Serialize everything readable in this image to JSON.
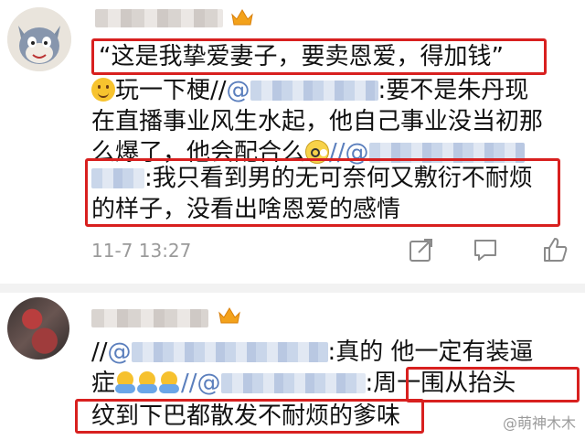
{
  "comment1": {
    "line1": "“这是我挚爱妻子，要卖恩爱，得加钱”",
    "line2_a": "玩一下梗//",
    "line2_mention": "@",
    "line2_b": ":要不是朱丹现",
    "line3": "在直播事业风生水起，他自己事业没当初那",
    "line4_a": "么爆了，他会配合么",
    "line4_mention": "//@",
    "line5": ":我只看到男的无可奈何又敷衍不耐烦",
    "line6": "的样子，没看出啥恩爱的感情",
    "time": "11-7 13:27",
    "icons": [
      "share-icon",
      "comment-icon",
      "like-icon"
    ]
  },
  "comment2": {
    "line1_a": "//",
    "line1_mention": "@",
    "line1_b": ":真的 他一定有装逼",
    "line2_a": "症",
    "line2_mention": "//@",
    "line2_b": ":周一围从抬头",
    "line3": "纹到下巴都散发不耐烦的爹味"
  },
  "watermark": "@萌神木木",
  "colors": {
    "highlight": "#d8201f",
    "mention": "#5b7fbd",
    "meta": "#9a9a9a"
  }
}
